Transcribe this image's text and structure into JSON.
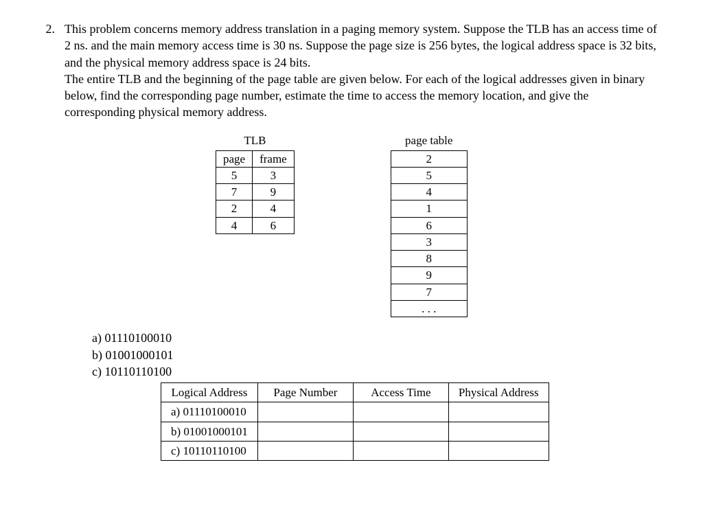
{
  "question_number": "2.",
  "prompt_p1": "This problem concerns memory address translation in a paging memory system. Suppose the TLB has an access time of 2 ns. and the main memory access time is 30 ns. Suppose the page size is 256 bytes, the logical address space is 32 bits, and the physical memory address space is 24 bits.",
  "prompt_p2": "The entire TLB and the beginning of the page table are given below. For each of the logical addresses given in binary below, find the corresponding page number, estimate the time to access the memory location, and give the corresponding physical memory address.",
  "tlb": {
    "title": "TLB",
    "headers": {
      "page": "page",
      "frame": "frame"
    },
    "rows": [
      {
        "page": "5",
        "frame": "3"
      },
      {
        "page": "7",
        "frame": "9"
      },
      {
        "page": "2",
        "frame": "4"
      },
      {
        "page": "4",
        "frame": "6"
      }
    ]
  },
  "page_table": {
    "title": "page table",
    "rows": [
      "2",
      "5",
      "4",
      "1",
      "6",
      "3",
      "8",
      "9",
      "7",
      ". . ."
    ]
  },
  "addresses": {
    "a_label": "a)",
    "a_value": "01110100010",
    "b_label": "b)",
    "b_value": "01001000101",
    "c_label": "c)",
    "c_value": "10110110100"
  },
  "answer_table": {
    "headers": {
      "la": "Logical Address",
      "pn": "Page Number",
      "at": "Access Time",
      "pa": "Physical Address"
    },
    "rows": [
      {
        "label": "a) 01110100010"
      },
      {
        "label": "b) 01001000101"
      },
      {
        "label": "c) 10110110100"
      }
    ]
  }
}
